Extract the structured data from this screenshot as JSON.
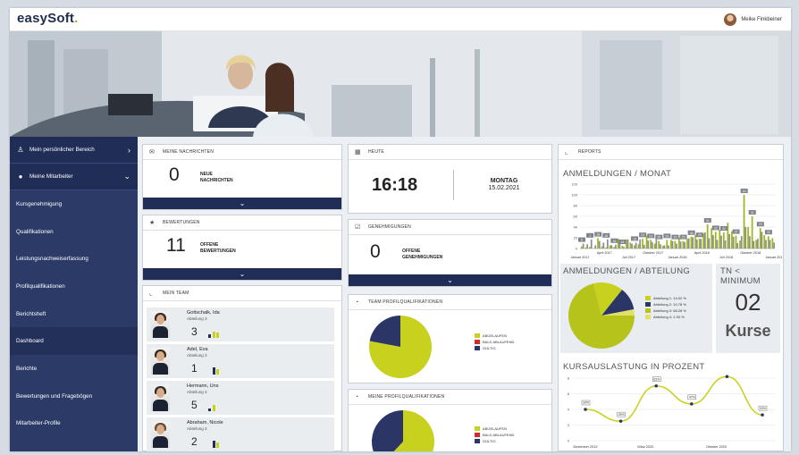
{
  "app": {
    "logo": "easySoft",
    "logo_dot": ".",
    "user_name": "Meike Finkbeiner"
  },
  "sidebar": {
    "personal": "Mein persönlicher Bereich",
    "staff": "Meine Mitarbeiter",
    "items": [
      {
        "label": "Kursgenehmigung"
      },
      {
        "label": "Qualifikationen"
      },
      {
        "label": "Leistungsnachweiserfassung"
      },
      {
        "label": "Profilqualifikationen"
      },
      {
        "label": "Berichtsheft"
      },
      {
        "label": "Dashboard",
        "active": true
      },
      {
        "label": "Berichte"
      },
      {
        "label": "Bewertungen und Fragebögen"
      },
      {
        "label": "Mitarbeiter-Profile"
      }
    ]
  },
  "messages": {
    "title": "MEINE NACHRICHTEN",
    "count": "0",
    "label1": "NEUE",
    "label2": "NACHRICHTEN"
  },
  "ratings": {
    "title": "BEWERTUNGEN",
    "count": "11",
    "label1": "OFFENE",
    "label2": "BEWERTUNGEN"
  },
  "today": {
    "title": "HEUTE",
    "time": "16:18",
    "weekday": "MONTAG",
    "date": "15.02.2021"
  },
  "approvals": {
    "title": "GENEHMIGUNGEN",
    "count": "0",
    "label1": "OFFENE",
    "label2": "GENEHMIGUNGEN"
  },
  "team": {
    "title": "MEIN TEAM",
    "members": [
      {
        "name": "Gottschalk, Ida",
        "dept": "Abteilung 3",
        "count": "3"
      },
      {
        "name": "Adel, Eva",
        "dept": "Abteilung 3",
        "count": "1"
      },
      {
        "name": "Hermann, Uns",
        "dept": "Abteilung 3",
        "count": "5"
      },
      {
        "name": "Abraham, Nicole",
        "dept": "Abteilung 3",
        "count": "2"
      }
    ]
  },
  "team_profile": {
    "title": "TEAM PROFILQUALIFIKATIONEN",
    "legend": [
      "ABGELAUFEN",
      "BALD ABLAUFEND",
      "GÜLTIG"
    ],
    "values": [
      0.78,
      0.0,
      0.22
    ]
  },
  "my_profile": {
    "title": "MEINE PROFILQUALIFIKATIONEN",
    "legend": [
      "ABGELAUFEN",
      "BALD ABLAUFEND",
      "GÜLTIG"
    ],
    "values": [
      0.62,
      0.0,
      0.38
    ]
  },
  "reports": {
    "title": "REPORTS",
    "monthly_title": "ANMELDUNGEN / MONAT",
    "dept_title": "ANMELDUNGEN / ABTEILUNG",
    "tn_title": "TN < MINIMUM",
    "tn_value": "02",
    "tn_unit": "Kurse",
    "util_title": "KURSAUSLASTUNG IN PROZENT"
  },
  "colors": {
    "navy": "#1f2d57",
    "sidebar": "#2b3a67",
    "lime": "#b5c31a",
    "red": "#d62a2a",
    "dark": "#2b3566",
    "gray": "#8a8f94"
  },
  "chart_data": [
    {
      "type": "bar",
      "title": "ANMELDUNGEN / MONAT",
      "ylim": [
        0,
        120
      ],
      "yticks": [
        0,
        20,
        40,
        60,
        80,
        100,
        120
      ],
      "xticks": [
        "Januar 2017",
        "April 2017",
        "Juli 2017",
        "Oktober 2017",
        "Januar 2018",
        "April 2018",
        "Juli 2018",
        "Oktober 2018",
        "Januar 2019"
      ],
      "series": [
        {
          "values": [
            4,
            2,
            3,
            0,
            19,
            4,
            2,
            6,
            3,
            18,
            5,
            17,
            11,
            6,
            8,
            18,
            24,
            16,
            9,
            14,
            5,
            16,
            16,
            14,
            20,
            14,
            18,
            22,
            25,
            18,
            28,
            45,
            38,
            31,
            35,
            30,
            48,
            32,
            24,
            15,
            100,
            40,
            60,
            16,
            38,
            25,
            23,
            19
          ]
        },
        {
          "values": [
            9,
            8,
            17,
            6,
            14,
            11,
            17,
            6,
            7,
            13,
            3,
            17,
            9,
            11,
            17,
            7,
            15,
            12,
            17,
            8,
            6,
            6,
            14,
            9,
            13,
            12,
            19,
            21,
            17,
            18,
            30,
            19,
            25,
            16,
            24,
            15,
            27,
            22,
            10,
            23,
            40,
            23,
            14,
            18,
            31,
            16,
            16,
            11
          ]
        }
      ],
      "labels": [
        "6",
        "1",
        "18",
        "16",
        "16",
        "18",
        "19",
        "23",
        "23",
        "26",
        "29",
        "23",
        "29",
        "35",
        "29",
        "31",
        "22",
        "32",
        "37",
        "40",
        "31",
        "29",
        "32"
      ]
    },
    {
      "type": "pie",
      "title": "ANMELDUNGEN / ABTEILUNG",
      "labels": [
        "Abteilung 1: 14.02 %",
        "Abteilung 2: 10.78 %",
        "Abteilung 3: 68.28 %",
        "Abteilung 4: 2.93 %"
      ],
      "values": [
        14.02,
        10.78,
        68.28,
        2.93
      ]
    },
    {
      "type": "line",
      "title": "KURSAUSLASTUNG IN PROZENT",
      "ylim": [
        0,
        8
      ],
      "yticks": [
        0,
        2,
        4,
        6,
        8
      ],
      "xticks": [
        "Dezember 2019",
        "März 2020",
        "Oktober 2020"
      ],
      "x": [
        0,
        1,
        2,
        3,
        4,
        5
      ],
      "values": [
        4,
        2.5,
        7,
        4.7,
        8.2,
        3.3
      ],
      "labels": [
        "33%",
        "25%",
        "63%",
        "47%",
        "80%",
        "33%"
      ]
    }
  ]
}
